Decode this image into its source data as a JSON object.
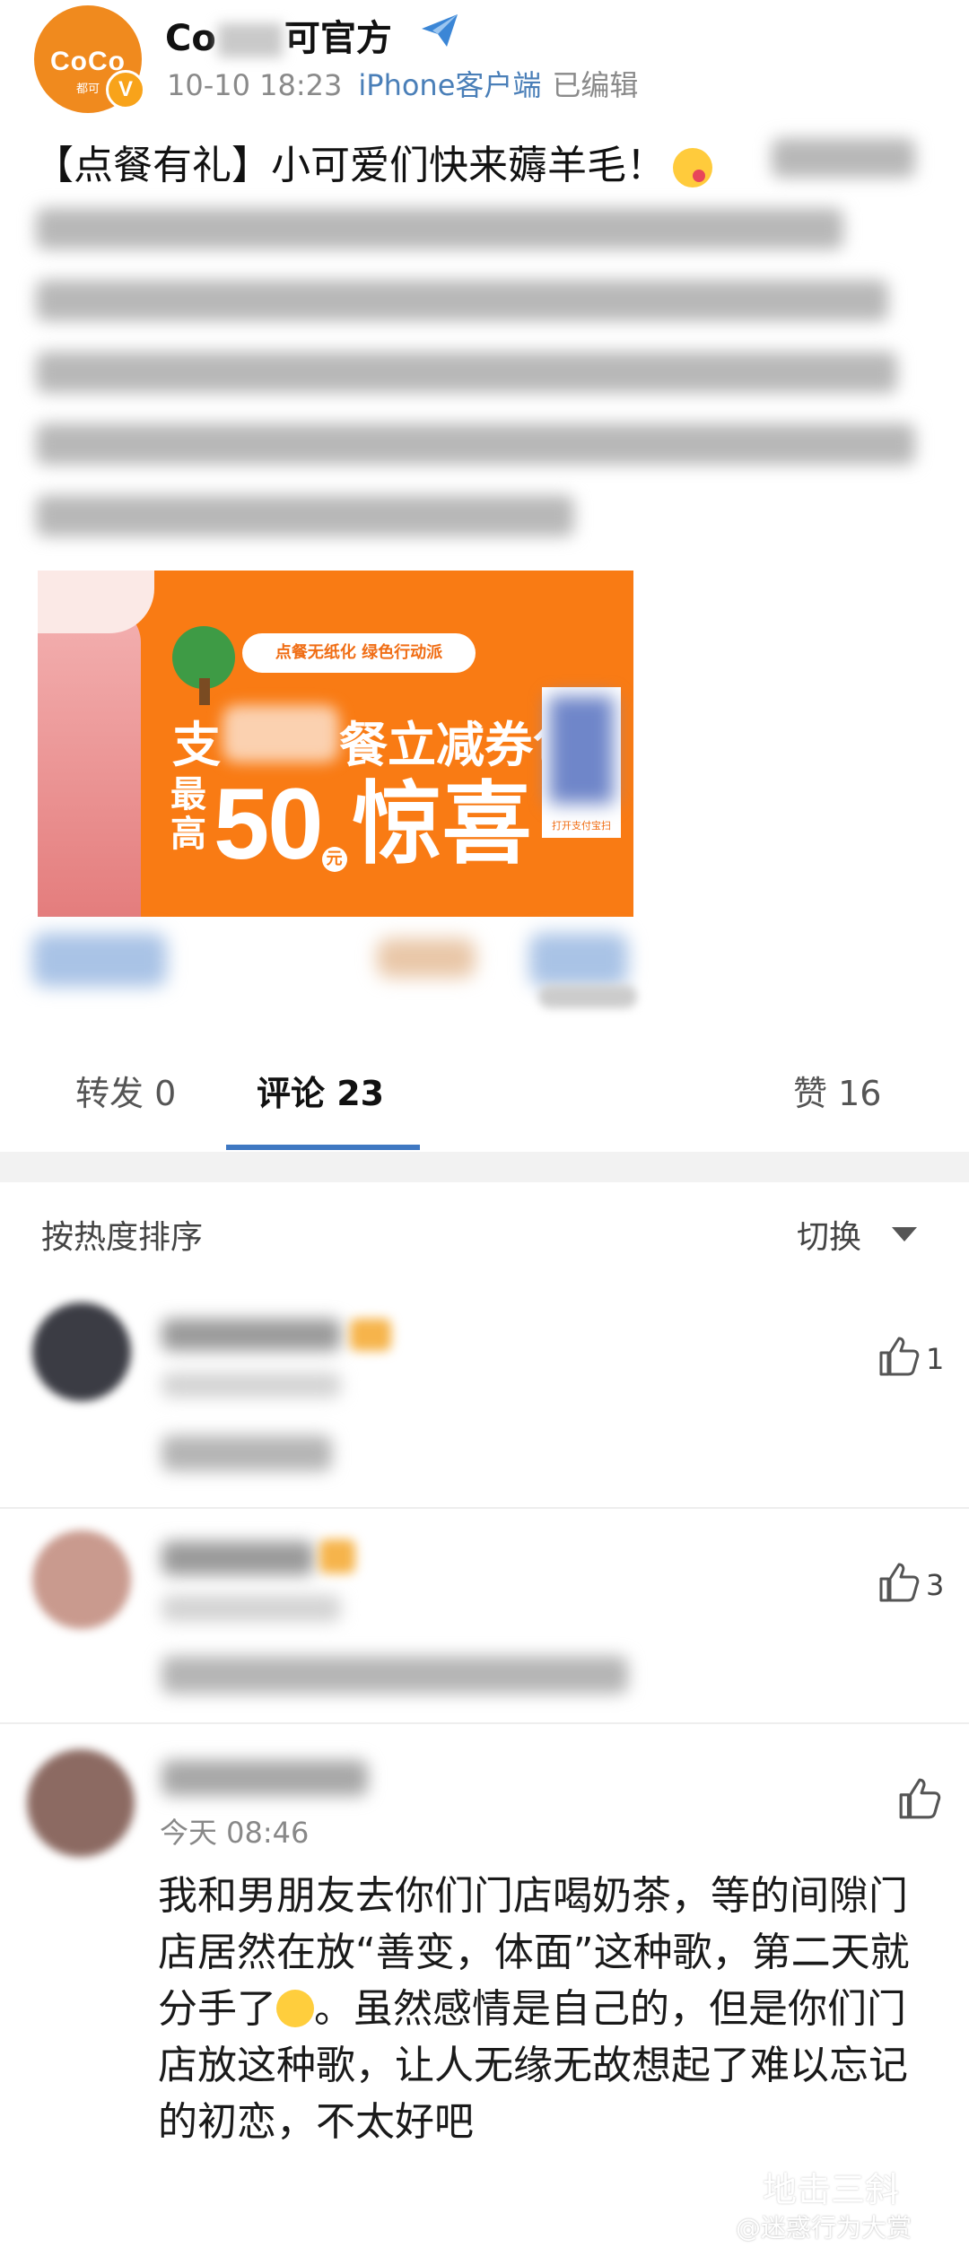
{
  "header": {
    "avatar_logo_text": "CoCo",
    "avatar_sub_text": "都可",
    "verified_badge": "V",
    "account_name_start": "Co",
    "account_name_end": "可官方",
    "post_time": "10-10 18:23",
    "client": "iPhone客户端",
    "edited": "已编辑"
  },
  "post": {
    "first_line": "【点餐有礼】小可爱们快来薅羊毛！"
  },
  "banner": {
    "tag_text": "点餐无纸化 绿色行动派",
    "title_start": "支",
    "title_end": "餐立减券包",
    "prefix": "最高",
    "amount": "50",
    "unit": "元",
    "suffix": "惊喜",
    "qr_caption": "打开支付宝扫"
  },
  "tabs": [
    {
      "label": "转发 0",
      "active": false
    },
    {
      "label": "评论 23",
      "active": true
    },
    {
      "label": "赞 16",
      "active": false
    }
  ],
  "sort": {
    "label": "按热度排序",
    "switch_label": "切换"
  },
  "comments": [
    {
      "likes": "1"
    },
    {
      "likes": "3"
    },
    {
      "time": "今天 08:46",
      "text_part1": "我和男朋友去你们门店喝奶茶，等的间隙门店居然在放“善变，体面”这种歌，第二天就分手了",
      "text_part2": "。虽然感情是自己的，但是你们门店放这种歌，让人无缘无故想起了难以忘记的初恋，不太好吧"
    }
  ],
  "watermark": {
    "line1": "地击三斜",
    "line2": "@迷惑行为大赏"
  },
  "colors": {
    "brand_orange": "#f97b14",
    "link_blue": "#4a7fb8",
    "tab_underline": "#3f78c2"
  }
}
